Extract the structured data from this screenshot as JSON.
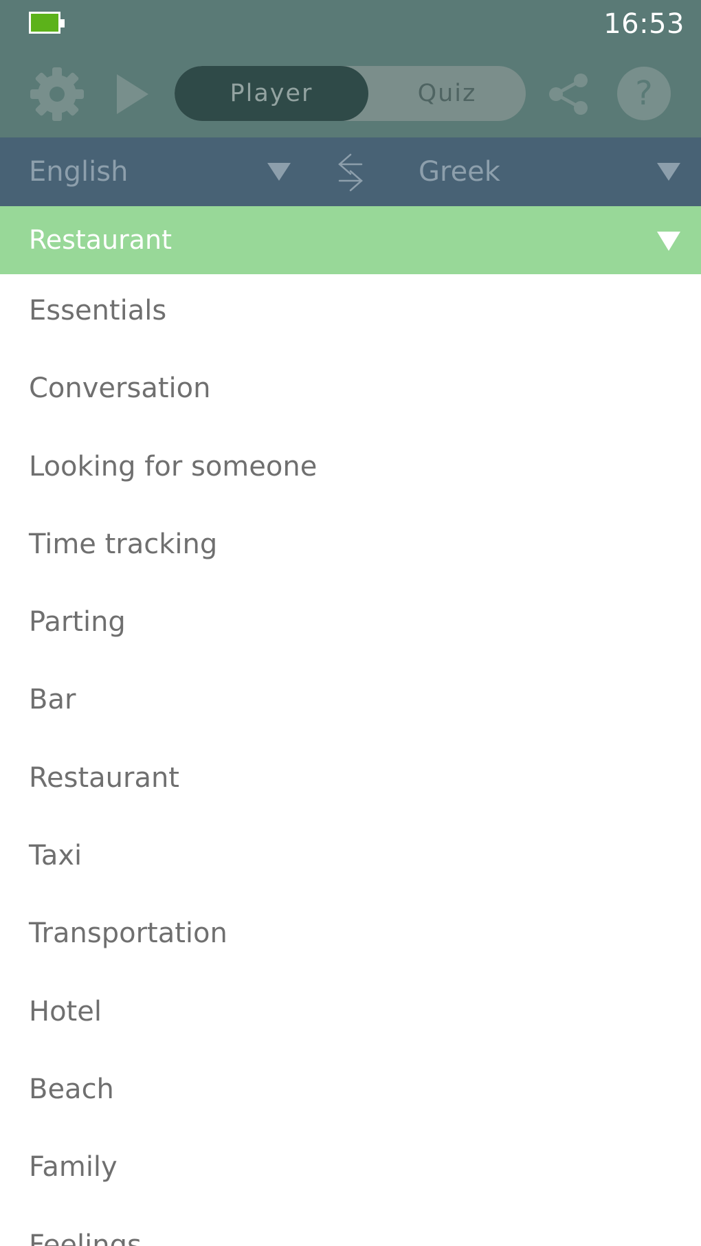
{
  "status_bar": {
    "time": "16:53",
    "battery_color": "#5cb21a"
  },
  "toolbar": {
    "settings_icon": "gear-icon",
    "play_icon": "play-icon",
    "mode_tabs": [
      {
        "label": "Player",
        "selected": true
      },
      {
        "label": "Quiz",
        "selected": false
      }
    ],
    "share_icon": "share-icon",
    "help_label": "?"
  },
  "language_bar": {
    "from_language": "English",
    "to_language": "Greek",
    "swap_icon": "swap-arrows-icon"
  },
  "category_selector": {
    "selected": "Restaurant"
  },
  "category_list": [
    "Essentials",
    "Conversation",
    "Looking for someone",
    "Time tracking",
    "Parting",
    "Bar",
    "Restaurant",
    "Taxi",
    "Transportation",
    "Hotel",
    "Beach",
    "Family",
    "Feelings"
  ],
  "colors": {
    "header": "#5a7a76",
    "language_bar": "#486275",
    "category_bar": "#98d898",
    "list_text": "#6f6f6f"
  }
}
